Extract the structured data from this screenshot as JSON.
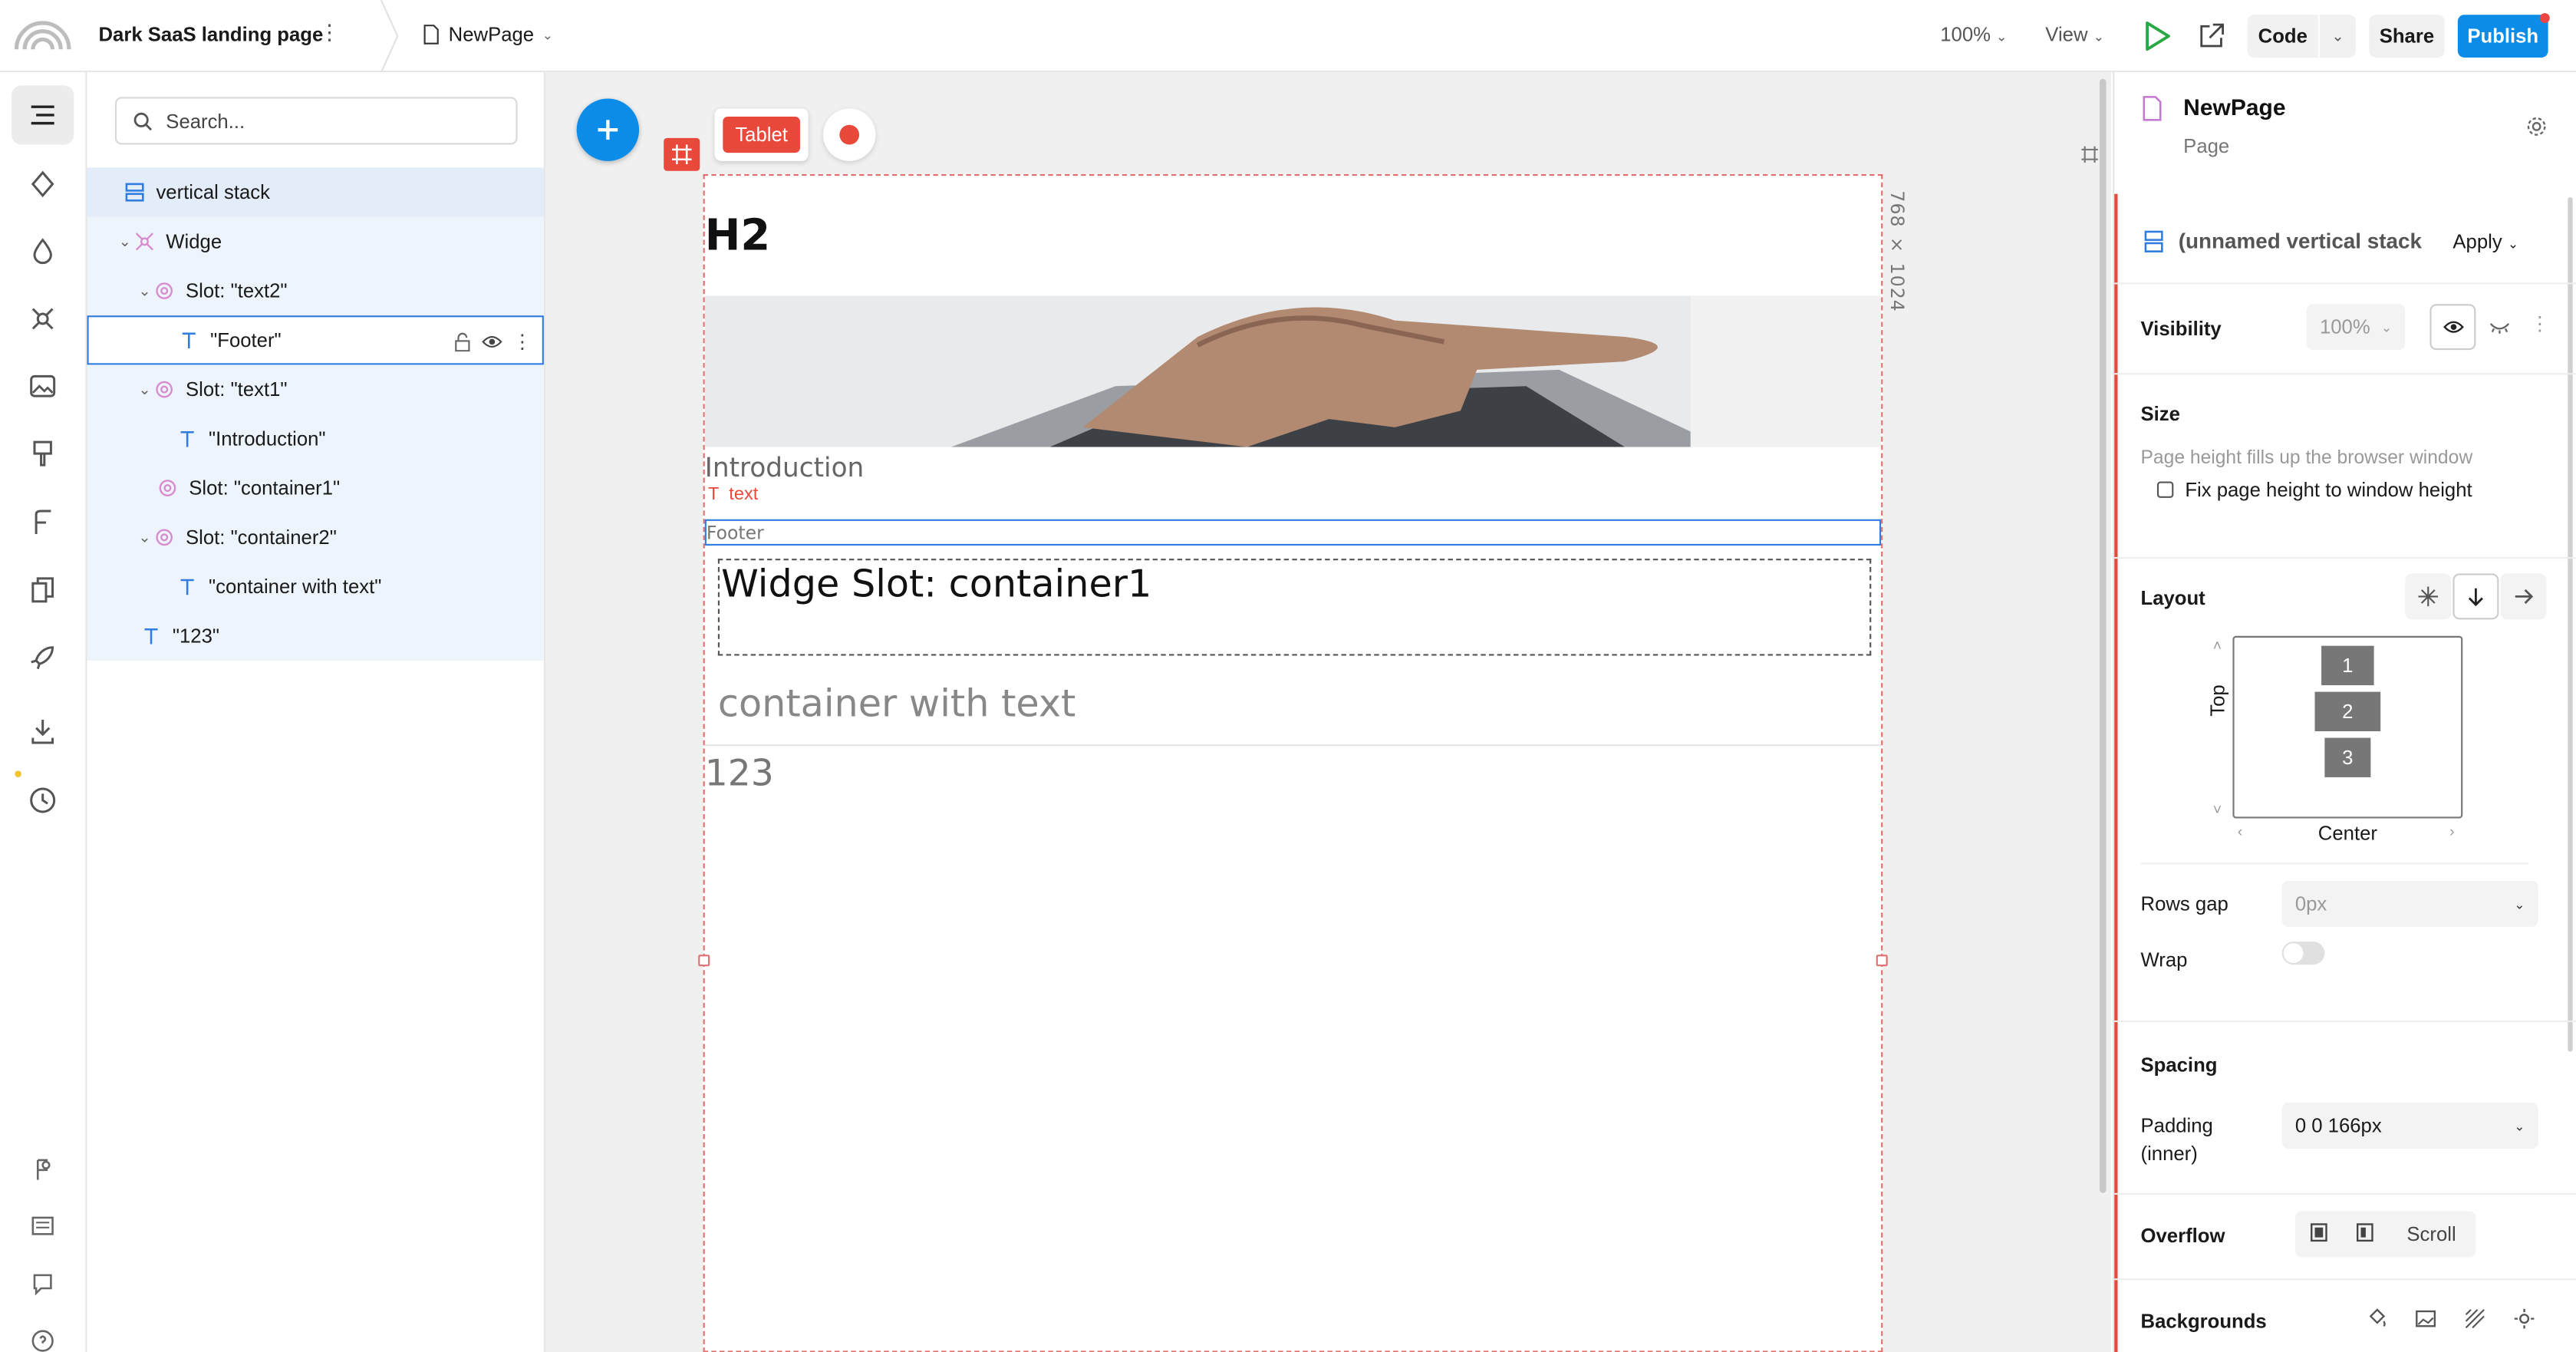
{
  "topbar": {
    "project_title": "Dark SaaS landing page",
    "project_menu": "⋮",
    "page_selector": "NewPage",
    "zoom": "100%",
    "view": "View",
    "code_label": "Code",
    "share_label": "Share",
    "publish_label": "Publish",
    "accent": "#0b8ce9"
  },
  "search": {
    "placeholder": "Search..."
  },
  "tree": {
    "items": [
      {
        "label": "vertical stack"
      },
      {
        "label": "Widge"
      },
      {
        "label": "Slot: \"text2\""
      },
      {
        "label": "\"Footer\""
      },
      {
        "label": "Slot: \"text1\""
      },
      {
        "label": "\"Introduction\""
      },
      {
        "label": "Slot: \"container1\""
      },
      {
        "label": "Slot: \"container2\""
      },
      {
        "label": "\"container with text\""
      },
      {
        "label": "\"123\""
      }
    ]
  },
  "canvas": {
    "device_label": "Tablet",
    "dimensions": "768 × 1024",
    "h2": "H2",
    "introduction": "Introduction",
    "text_tag": "text",
    "footer": "Footer",
    "slot_text": "Widge Slot: container1",
    "container_text": "container with text",
    "number_text": "123",
    "frame_color": "#e8493a"
  },
  "props": {
    "page_name": "NewPage",
    "page_type": "Page",
    "stack_name": "(unnamed vertical stack",
    "apply_label": "Apply",
    "visibility_label": "Visibility",
    "visibility_value": "100%",
    "size_label": "Size",
    "size_note": "Page height fills up the browser window",
    "fix_height_label": "Fix page height to window height",
    "layout_label": "Layout",
    "axis_top": "Top",
    "axis_center": "Center",
    "layout_items": [
      "1",
      "2",
      "3"
    ],
    "rows_gap_label": "Rows gap",
    "rows_gap_value": "0px",
    "wrap_label": "Wrap",
    "spacing_label": "Spacing",
    "padding_label": "Padding",
    "padding_sub": "(inner)",
    "padding_value": "0 0 166px",
    "overflow_label": "Overflow",
    "overflow_value": "Scroll",
    "backgrounds_label": "Backgrounds"
  }
}
